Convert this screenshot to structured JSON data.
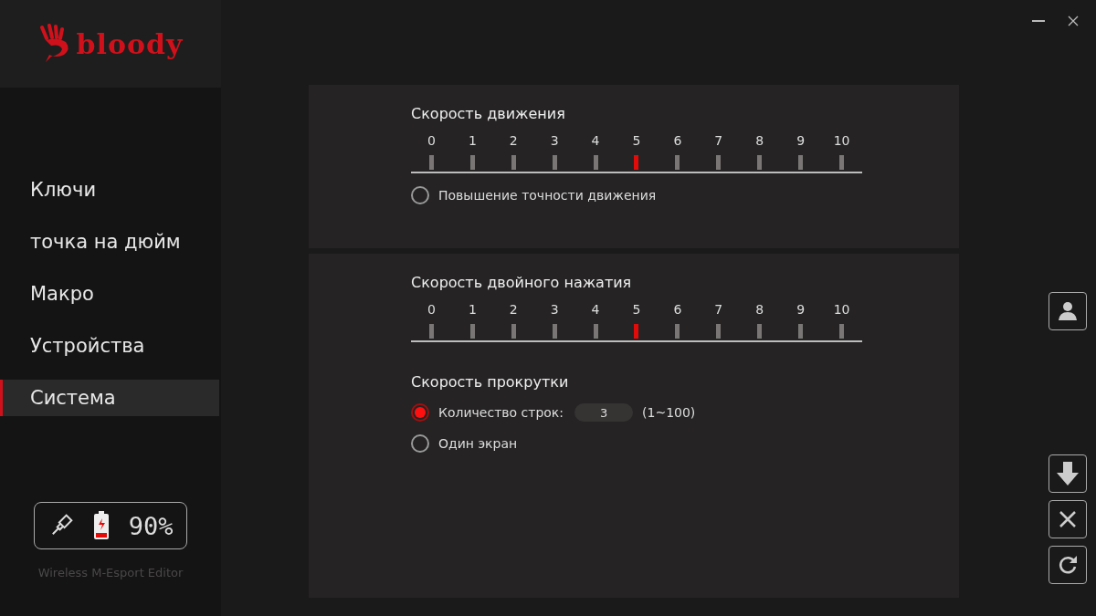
{
  "logo": {
    "text": "bloody"
  },
  "sidebar": {
    "items": [
      {
        "label": "Ключи",
        "selected": false
      },
      {
        "label": "точка на дюйм",
        "selected": false
      },
      {
        "label": "Макро",
        "selected": false
      },
      {
        "label": "Устройства",
        "selected": false
      },
      {
        "label": "Система",
        "selected": true
      }
    ]
  },
  "device": {
    "battery": "90%",
    "editor": "Wireless M-Esport Editor"
  },
  "sections": [
    {
      "title": "Скорость движения",
      "ticks": [
        {
          "label": "0",
          "selected": false
        },
        {
          "label": "1",
          "selected": false
        },
        {
          "label": "2",
          "selected": false
        },
        {
          "label": "3",
          "selected": false
        },
        {
          "label": "4",
          "selected": false
        },
        {
          "label": "5",
          "selected": true
        },
        {
          "label": "6",
          "selected": false
        },
        {
          "label": "7",
          "selected": false
        },
        {
          "label": "8",
          "selected": false
        },
        {
          "label": "9",
          "selected": false
        },
        {
          "label": "10",
          "selected": false
        }
      ],
      "options": [
        {
          "label": "Повышение точности движения",
          "selected": false
        }
      ]
    },
    {
      "title": "Скорость двойного нажатия",
      "ticks": [
        {
          "label": "0",
          "selected": false
        },
        {
          "label": "1",
          "selected": false
        },
        {
          "label": "2",
          "selected": false
        },
        {
          "label": "3",
          "selected": false
        },
        {
          "label": "4",
          "selected": false
        },
        {
          "label": "5",
          "selected": true
        },
        {
          "label": "6",
          "selected": false
        },
        {
          "label": "7",
          "selected": false
        },
        {
          "label": "8",
          "selected": false
        },
        {
          "label": "9",
          "selected": false
        },
        {
          "label": "10",
          "selected": false
        }
      ],
      "subtitle": "Скорость прокрутки",
      "options": [
        {
          "label": "Количество строк:",
          "selected": true,
          "value": "3",
          "range": "(1~100)"
        },
        {
          "label": "Один экран",
          "selected": false
        }
      ]
    }
  ],
  "side_buttons": [
    {
      "kind": "profile"
    },
    {
      "kind": "download"
    },
    {
      "kind": "close"
    },
    {
      "kind": "reset"
    }
  ]
}
